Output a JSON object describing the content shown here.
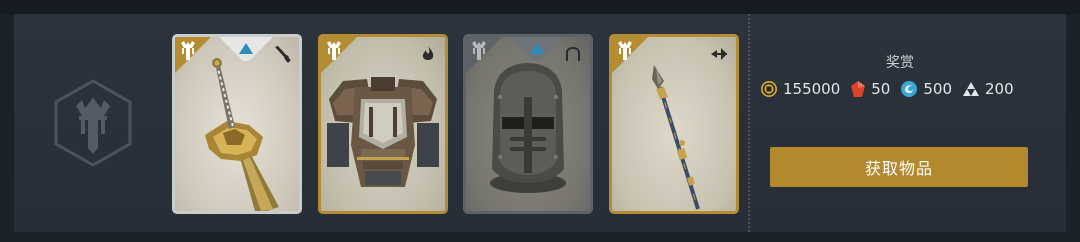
{
  "bundle": {
    "emblem_icon": "faction-crest-icon",
    "cards": [
      {
        "name": "greatsword",
        "rarity": "silver",
        "frame_color": "#cbccce",
        "type_icon": "sword-slot-icon",
        "tier_icon": "tier-triangle-icon",
        "badge_icon": "faction-crest-icon"
      },
      {
        "name": "chest-armor",
        "rarity": "gold",
        "frame_color": "#b48d32",
        "type_icon": "flame-slot-icon",
        "badge_icon": "faction-crest-icon"
      },
      {
        "name": "knight-helmet",
        "rarity": "gray",
        "frame_color": "#5e636a",
        "type_icon": "helmet-slot-icon",
        "tier_icon": "tier-triangle-icon",
        "badge_icon": "faction-crest-icon"
      },
      {
        "name": "spear",
        "rarity": "gold",
        "frame_color": "#b48d32",
        "type_icon": "dart-slot-icon",
        "badge_icon": "faction-crest-icon"
      }
    ]
  },
  "rewards": {
    "title": "奖赏",
    "items": [
      {
        "icon": "gold-coin-icon",
        "amount": "155000",
        "color": "#d7a928"
      },
      {
        "icon": "red-gem-icon",
        "amount": "50",
        "color": "#d8442c"
      },
      {
        "icon": "blue-swirl-icon",
        "amount": "500",
        "color": "#3ea6d6"
      },
      {
        "icon": "triforce-icon",
        "amount": "200",
        "color": "#e4e7ea"
      }
    ]
  },
  "claim_button": {
    "label": "获取物品",
    "color": "#b3892e"
  }
}
